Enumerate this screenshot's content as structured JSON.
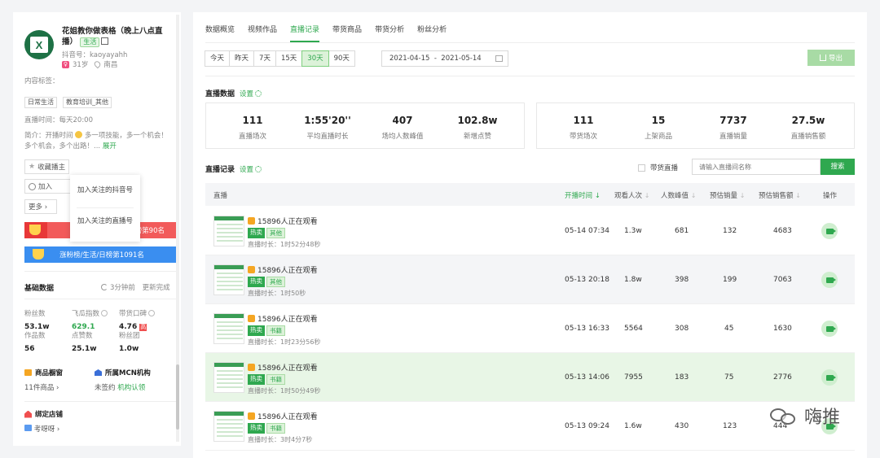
{
  "profile": {
    "name": "花姐教你做表格（晚上八点直播）",
    "category_tag": "生活",
    "douyin_id": "抖音号：kaoyayahh",
    "age": "31岁",
    "location": "南昌",
    "avatar_letter": "X",
    "content_tags_label": "内容标签：",
    "content_tags": [
      "日常生活",
      "教育培训_其他"
    ],
    "live_time": "直播时间：每天20:00",
    "intro_a": "简介：开播时间",
    "intro_b": "多一项技能，多一个机会！多个机会，多个出路！...",
    "intro_more": "展开",
    "fav_label": "收藏播主",
    "add_label": "加入",
    "more_label": "更多",
    "popup_item_1": "加入关注的抖音号",
    "popup_item_2": "加入关注的直播号",
    "rank_red": "榜第90名",
    "rank_blue": "涨粉榜/生活/日榜第1091名"
  },
  "basic": {
    "title": "基础数据",
    "refresh_time": "3分钟前",
    "refresh_done": "更新完成",
    "stats": [
      {
        "label": "粉丝数",
        "value": "53.1w"
      },
      {
        "label": "飞瓜指数",
        "value": "629.1"
      },
      {
        "label": "带货口碑",
        "value": "4.76",
        "badge": "高"
      },
      {
        "label": "作品数",
        "value": "56"
      },
      {
        "label": "点赞数",
        "value": "25.1w"
      },
      {
        "label": "粉丝团",
        "value": "1.0w"
      }
    ],
    "showcase_title": "商品橱窗",
    "showcase_value": "11件商品",
    "mcn_title": "所属MCN机构",
    "mcn_value": "未签约",
    "mcn_link": "机构认领",
    "shop_title": "绑定店铺",
    "shop_value": "考呀呀"
  },
  "nav": {
    "tabs": [
      "数据概览",
      "视频作品",
      "直播记录",
      "带货商品",
      "带货分析",
      "粉丝分析"
    ],
    "active_tab": "直播记录"
  },
  "range": {
    "options": [
      "今天",
      "昨天",
      "7天",
      "15天",
      "30天",
      "90天"
    ],
    "selected": "30天",
    "start": "2021-04-15",
    "sep": "-",
    "end": "2021-05-14",
    "export_label": "导出"
  },
  "live_data": {
    "title": "直播数据",
    "settings": "设置",
    "left_kpis": [
      {
        "value": "111",
        "label": "直播场次"
      },
      {
        "value": "1:55'20''",
        "label": "平均直播时长"
      },
      {
        "value": "407",
        "label": "场均人数峰值"
      },
      {
        "value": "102.8w",
        "label": "新增点赞"
      }
    ],
    "right_kpis": [
      {
        "value": "111",
        "label": "带货场次"
      },
      {
        "value": "15",
        "label": "上架商品"
      },
      {
        "value": "7737",
        "label": "直播销量"
      },
      {
        "value": "27.5w",
        "label": "直播销售额"
      }
    ]
  },
  "records": {
    "title": "直播记录",
    "settings": "设置",
    "goods_filter": "带货直播",
    "search_placeholder": "请输入直播间名称",
    "search_button": "搜索",
    "columns": [
      "直播",
      "开播时间",
      "观看人次",
      "人数峰值",
      "预估销量",
      "预估销售额",
      "操作"
    ],
    "rows": [
      {
        "title": "15896人正在观看",
        "hot": "热卖",
        "cat": "其他",
        "duration": "直播时长：1时52分48秒",
        "time": "05-14 07:34",
        "views": "1.3w",
        "peak": "681",
        "sales": "132",
        "revenue": "4683"
      },
      {
        "title": "15896人正在观看",
        "hot": "热卖",
        "cat": "其他",
        "duration": "直播时长：1时50秒",
        "time": "05-13 20:18",
        "views": "1.8w",
        "peak": "398",
        "sales": "199",
        "revenue": "7063"
      },
      {
        "title": "15896人正在观看",
        "hot": "热卖",
        "cat": "书籍",
        "duration": "直播时长：1时23分56秒",
        "time": "05-13 16:33",
        "views": "5564",
        "peak": "308",
        "sales": "45",
        "revenue": "1630"
      },
      {
        "title": "15896人正在观看",
        "hot": "热卖",
        "cat": "书籍",
        "duration": "直播时长：1时50分49秒",
        "time": "05-13 14:06",
        "views": "7955",
        "peak": "183",
        "sales": "75",
        "revenue": "2776"
      },
      {
        "title": "15896人正在观看",
        "hot": "热卖",
        "cat": "书籍",
        "duration": "直播时长：3时4分7秒",
        "time": "05-13 09:24",
        "views": "1.6w",
        "peak": "430",
        "sales": "123",
        "revenue": "444"
      }
    ]
  },
  "watermark": "嗨推",
  "colors": {
    "accent": "#2fa84f",
    "rank_red": "#f25b5b",
    "rank_blue": "#3a8ef0"
  }
}
